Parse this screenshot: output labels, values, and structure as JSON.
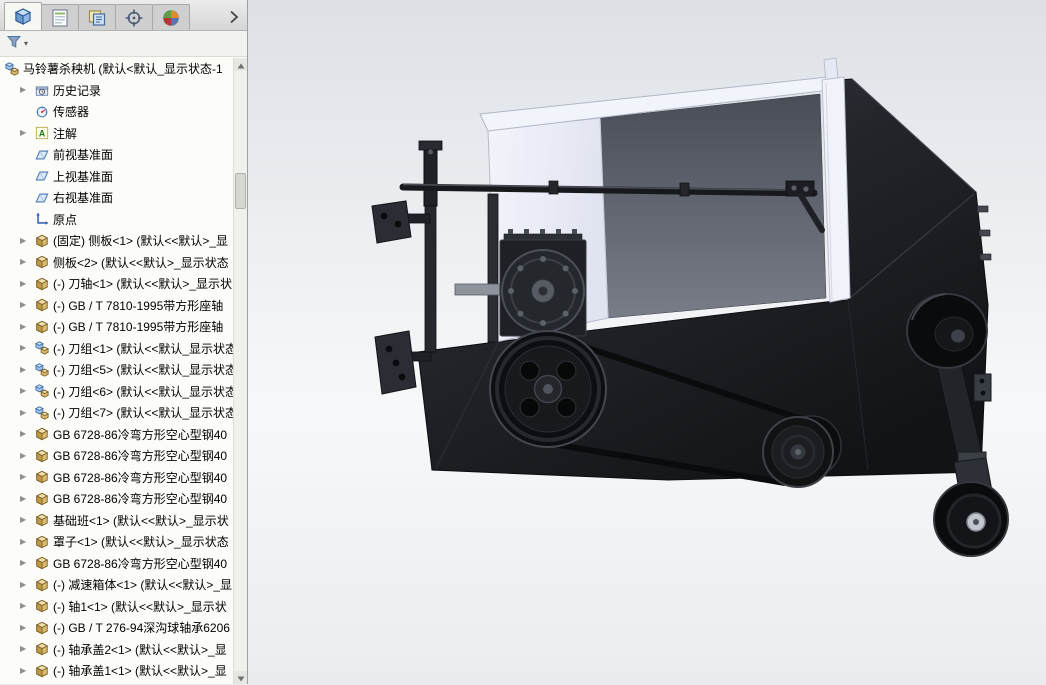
{
  "panel_tabs": [
    {
      "name": "featuremanager",
      "icon": "featuremanager-icon",
      "selected": true
    },
    {
      "name": "propertymanager",
      "icon": "propertymanager-icon",
      "selected": false
    },
    {
      "name": "configurationmanager",
      "icon": "configurationmanager-icon",
      "selected": false
    },
    {
      "name": "dimxpertmanager",
      "icon": "dimxpert-icon",
      "selected": false
    },
    {
      "name": "displaymanager",
      "icon": "displaymanager-icon",
      "selected": false
    }
  ],
  "filter": {
    "icon": "filter-icon"
  },
  "feature_tree": {
    "items": [
      {
        "label": "马铃薯杀秧机 (默认<默认_显示状态-1",
        "icon": "assembly-icon",
        "arrow": false,
        "root": true
      },
      {
        "label": "历史记录",
        "icon": "history-icon",
        "arrow": true
      },
      {
        "label": "传感器",
        "icon": "sensor-icon",
        "arrow": false
      },
      {
        "label": "注解",
        "icon": "annotation-icon",
        "arrow": true
      },
      {
        "label": "前视基准面",
        "icon": "plane-icon",
        "arrow": false
      },
      {
        "label": "上视基准面",
        "icon": "plane-icon",
        "arrow": false
      },
      {
        "label": "右视基准面",
        "icon": "plane-icon",
        "arrow": false
      },
      {
        "label": "原点",
        "icon": "origin-icon",
        "arrow": false
      },
      {
        "label": "(固定) 侧板<1> (默认<<默认>_显",
        "icon": "part-icon",
        "arrow": true
      },
      {
        "label": "侧板<2> (默认<<默认>_显示状态",
        "icon": "part-icon",
        "arrow": true
      },
      {
        "label": "(-) 刀轴<1> (默认<<默认>_显示状",
        "icon": "part-icon",
        "arrow": true
      },
      {
        "label": "(-) GB / T 7810-1995带方形座轴",
        "icon": "part-icon",
        "arrow": true
      },
      {
        "label": "(-) GB / T 7810-1995带方形座轴",
        "icon": "part-icon",
        "arrow": true
      },
      {
        "label": "(-) 刀组<1> (默认<<默认_显示状态",
        "icon": "assembly-icon",
        "arrow": true
      },
      {
        "label": "(-) 刀组<5> (默认<<默认_显示状态",
        "icon": "assembly-icon",
        "arrow": true
      },
      {
        "label": "(-) 刀组<6> (默认<<默认_显示状态",
        "icon": "assembly-icon",
        "arrow": true
      },
      {
        "label": "(-) 刀组<7> (默认<<默认_显示状态",
        "icon": "assembly-icon",
        "arrow": true
      },
      {
        "label": "GB 6728-86冷弯方形空心型钢40",
        "icon": "part-icon",
        "arrow": true
      },
      {
        "label": "GB 6728-86冷弯方形空心型钢40",
        "icon": "part-icon",
        "arrow": true
      },
      {
        "label": "GB 6728-86冷弯方形空心型钢40",
        "icon": "part-icon",
        "arrow": true
      },
      {
        "label": "GB 6728-86冷弯方形空心型钢40",
        "icon": "part-icon",
        "arrow": true
      },
      {
        "label": "基础班<1> (默认<<默认>_显示状",
        "icon": "part-icon",
        "arrow": true
      },
      {
        "label": "罩子<1> (默认<<默认>_显示状态",
        "icon": "part-icon",
        "arrow": true
      },
      {
        "label": "GB 6728-86冷弯方形空心型钢40",
        "icon": "part-icon",
        "arrow": true
      },
      {
        "label": "(-) 减速箱体<1> (默认<<默认>_显",
        "icon": "part-icon",
        "arrow": true
      },
      {
        "label": "(-) 轴1<1> (默认<<默认>_显示状",
        "icon": "part-icon",
        "arrow": true
      },
      {
        "label": "(-) GB / T 276-94深沟球轴承6206",
        "icon": "part-icon",
        "arrow": true
      },
      {
        "label": "(-) 轴承盖2<1> (默认<<默认>_显",
        "icon": "part-icon",
        "arrow": true
      },
      {
        "label": "(-) 轴承盖1<1> (默认<<默认>_显",
        "icon": "part-icon",
        "arrow": true
      }
    ]
  },
  "viewport": {
    "colors": {
      "panel_white": "#f2f4fb",
      "panel_light": "#e9ebf7",
      "body_dark": "#17191d",
      "background_top": "#dde1e6",
      "background_bottom": "#eaecef"
    }
  }
}
